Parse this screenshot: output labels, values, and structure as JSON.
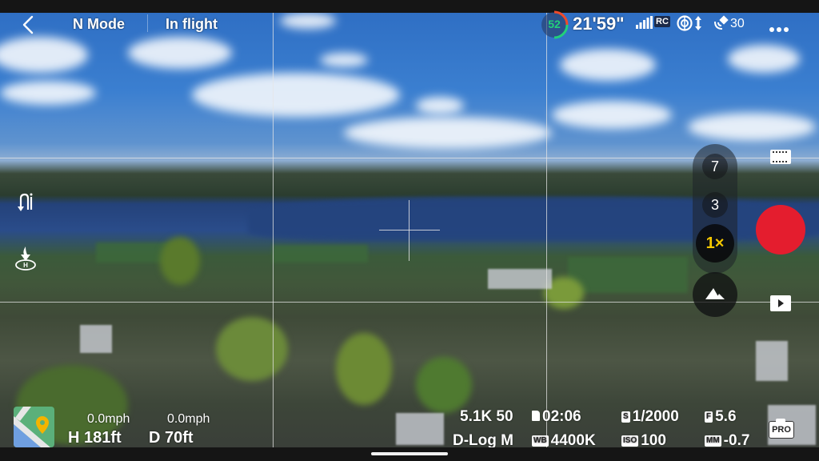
{
  "header": {
    "back_icon": "chevron-left-icon",
    "flight_mode": "N Mode",
    "flight_status": "In flight",
    "battery_percent": "52",
    "flight_time_remaining": "21'59\"",
    "rc_label": "RC",
    "obstacle_icon": "obstacle-avoidance-icon",
    "gps_satellites": "30",
    "more_icon": "more-options-icon"
  },
  "left_controls": {
    "takeoff_icon": "auto-takeoff-icon",
    "rth_icon": "return-to-home-icon"
  },
  "zoom_levels": [
    {
      "label": "7"
    },
    {
      "label": "3"
    },
    {
      "label": "1×",
      "active": true
    }
  ],
  "right_controls": {
    "scene_icon": "landscape-mode-icon",
    "video_mode_icon": "film-icon",
    "playback_icon": "play-icon",
    "record_color": "#e41d2e"
  },
  "telemetry": {
    "vertical_speed": "0.0mph",
    "horizontal_speed": "0.0mph",
    "height": "H 181ft",
    "distance": "D 70ft"
  },
  "camera": {
    "resolution_fps": "5.1K 50",
    "sd_icon_label": "▮",
    "record_time_remaining": "02:06",
    "color_profile": "D-Log M",
    "wb_label": "WB",
    "white_balance": "4400K",
    "shutter_label": "S",
    "shutter": "1/2000",
    "iso_label": "ISO",
    "iso": "100",
    "aperture_label": "F",
    "aperture": "5.6",
    "ev_label": "MM",
    "exposure_comp": "-0.7",
    "pro_label": "PRO"
  },
  "colors": {
    "accent_yellow": "#f5c800",
    "battery_green": "#22d07a",
    "battery_warning": "#f04a2a"
  }
}
